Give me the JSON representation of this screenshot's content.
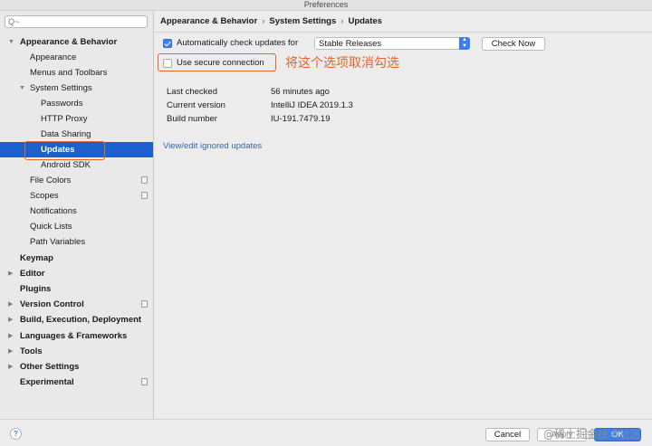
{
  "window": {
    "title": "Preferences"
  },
  "search": {
    "placeholder": "Q~"
  },
  "sidebar": {
    "items": [
      {
        "label": "Appearance & Behavior",
        "arrow": "▼"
      },
      {
        "label": "Appearance"
      },
      {
        "label": "Menus and Toolbars"
      },
      {
        "label": "System Settings",
        "arrow": "▼"
      },
      {
        "label": "Passwords"
      },
      {
        "label": "HTTP Proxy"
      },
      {
        "label": "Data Sharing"
      },
      {
        "label": "Updates"
      },
      {
        "label": "Android SDK"
      },
      {
        "label": "File Colors"
      },
      {
        "label": "Scopes"
      },
      {
        "label": "Notifications"
      },
      {
        "label": "Quick Lists"
      },
      {
        "label": "Path Variables"
      },
      {
        "label": "Keymap"
      },
      {
        "label": "Editor",
        "arrow": "▶"
      },
      {
        "label": "Plugins"
      },
      {
        "label": "Version Control",
        "arrow": "▶"
      },
      {
        "label": "Build, Execution, Deployment",
        "arrow": "▶"
      },
      {
        "label": "Languages & Frameworks",
        "arrow": "▶"
      },
      {
        "label": "Tools",
        "arrow": "▶"
      },
      {
        "label": "Other Settings",
        "arrow": "▶"
      },
      {
        "label": "Experimental"
      }
    ]
  },
  "breadcrumb": {
    "part1": "Appearance & Behavior",
    "part2": "System Settings",
    "part3": "Updates",
    "separator": "›"
  },
  "updates": {
    "auto_check_label": "Automatically check updates for",
    "auto_check_checked": true,
    "channel_selected": "Stable Releases",
    "channel_arrows": "▲\n▼",
    "check_now_label": "Check Now",
    "secure_connection_label": "Use secure connection",
    "secure_connection_checked": false,
    "annotation": "将这个选项取消勾选",
    "last_checked_label": "Last checked",
    "last_checked_value": "56 minutes ago",
    "current_version_label": "Current version",
    "current_version_value": "IntelliJ IDEA 2019.1.3",
    "build_number_label": "Build number",
    "build_number_value": "IU-191.7479.19",
    "ignored_link": "View/edit ignored updates"
  },
  "footer": {
    "help": "?",
    "cancel": "Cancel",
    "apply": "Apply",
    "ok": "OK",
    "watermark": "@稀土掘金技术社区"
  },
  "colors": {
    "accent": "#3c7ef0",
    "selection": "#1e5fce",
    "annotation": "#e8642b",
    "link": "#2f65c4"
  }
}
